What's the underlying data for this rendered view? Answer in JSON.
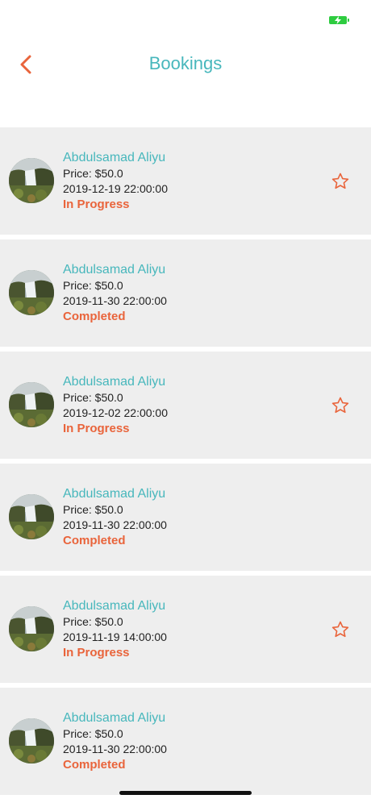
{
  "colors": {
    "accent_teal": "#47b7bc",
    "accent_orange": "#e9643b",
    "row_background": "#eeeeee"
  },
  "nav": {
    "title": "Bookings",
    "back_icon": "chevron-left-icon"
  },
  "bookings": [
    {
      "name": "Abdulsamad Aliyu",
      "price": "Price: $50.0",
      "date": "2019-12-19 22:00:00",
      "status": "In Progress",
      "star_visible": true
    },
    {
      "name": "Abdulsamad Aliyu",
      "price": "Price: $50.0",
      "date": "2019-11-30 22:00:00",
      "status": "Completed",
      "star_visible": false
    },
    {
      "name": "Abdulsamad Aliyu",
      "price": "Price: $50.0",
      "date": "2019-12-02 22:00:00",
      "status": "In Progress",
      "star_visible": true
    },
    {
      "name": "Abdulsamad Aliyu",
      "price": "Price: $50.0",
      "date": "2019-11-30 22:00:00",
      "status": "Completed",
      "star_visible": false
    },
    {
      "name": "Abdulsamad Aliyu",
      "price": "Price: $50.0",
      "date": "2019-11-19 14:00:00",
      "status": "In Progress",
      "star_visible": true
    },
    {
      "name": "Abdulsamad Aliyu",
      "price": "Price: $50.0",
      "date": "2019-11-30 22:00:00",
      "status": "Completed",
      "star_visible": false
    }
  ]
}
